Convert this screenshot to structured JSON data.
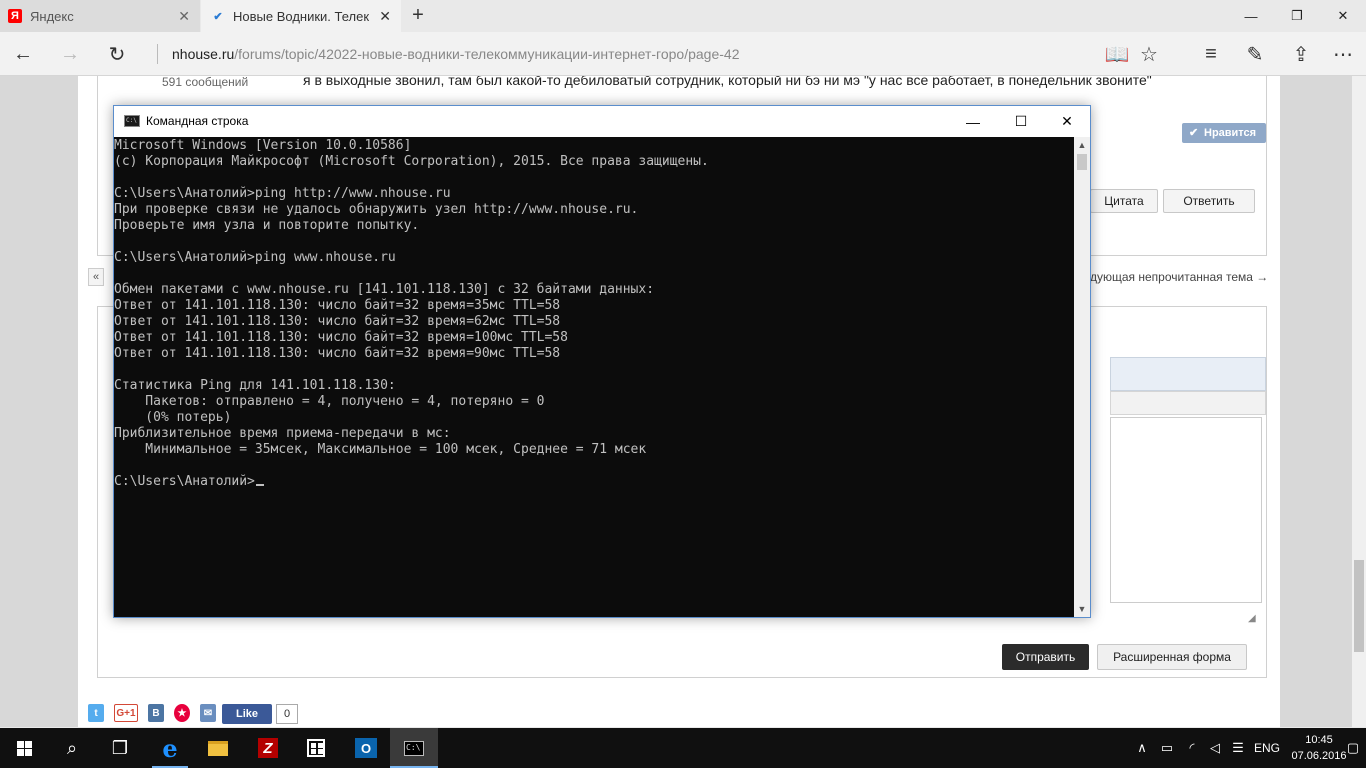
{
  "browser": {
    "tabs": [
      {
        "title": "Яндекс",
        "favicon": "yandex-icon"
      },
      {
        "title": "Новые Водники. Телек",
        "favicon": "forum-icon",
        "active": true
      }
    ],
    "new_tab_symbol": "+",
    "window_controls": {
      "minimize": "—",
      "maximize": "❐",
      "close": "✕"
    },
    "url_host": "nhouse.ru",
    "url_path": "/forums/topic/42022-новые-водники-телекоммуникации-интернет-горо/page-42"
  },
  "forum": {
    "post_count": "591 сообщений",
    "post_text": "я в выходные звонил, там был какой-то дебиловатый сотрудник, который ни бэ ни мэ \"у нас все работает, в понедельник звоните\"",
    "like_label": "Нравится",
    "quote_label": "Цитата",
    "reply_label": "Ответить",
    "prev_symbol": "«",
    "next_unread": "дующая непрочитанная тема →",
    "send_label": "Отправить",
    "advanced_label": "Расширенная форма",
    "social": {
      "twitter": "t",
      "gplus": "G+1",
      "vk": "B",
      "mail": "✉",
      "fb_like": "Like",
      "fb_count": "0"
    }
  },
  "cmd": {
    "title": "Командная строка",
    "controls": {
      "minimize": "—",
      "maximize": "☐",
      "close": "✕"
    },
    "lines": [
      "Microsoft Windows [Version 10.0.10586]",
      "(c) Корпорация Майкрософт (Microsoft Corporation), 2015. Все права защищены.",
      "",
      "C:\\Users\\Анатолий>ping http://www.nhouse.ru",
      "При проверке связи не удалось обнаружить узел http://www.nhouse.ru.",
      "Проверьте имя узла и повторите попытку.",
      "",
      "C:\\Users\\Анатолий>ping www.nhouse.ru",
      "",
      "Обмен пакетами с www.nhouse.ru [141.101.118.130] с 32 байтами данных:",
      "Ответ от 141.101.118.130: число байт=32 время=35мс TTL=58",
      "Ответ от 141.101.118.130: число байт=32 время=62мс TTL=58",
      "Ответ от 141.101.118.130: число байт=32 время=100мс TTL=58",
      "Ответ от 141.101.118.130: число байт=32 время=90мс TTL=58",
      "",
      "Статистика Ping для 141.101.118.130:",
      "    Пакетов: отправлено = 4, получено = 4, потеряно = 0",
      "    (0% потерь)",
      "Приблизительное время приема-передачи в мс:",
      "    Минимальное = 35мсек, Максимальное = 100 мсек, Среднее = 71 мсек",
      "",
      "C:\\Users\\Анатолий>"
    ]
  },
  "taskbar": {
    "language": "ENG",
    "time": "10:45",
    "date": "07.06.2016"
  }
}
